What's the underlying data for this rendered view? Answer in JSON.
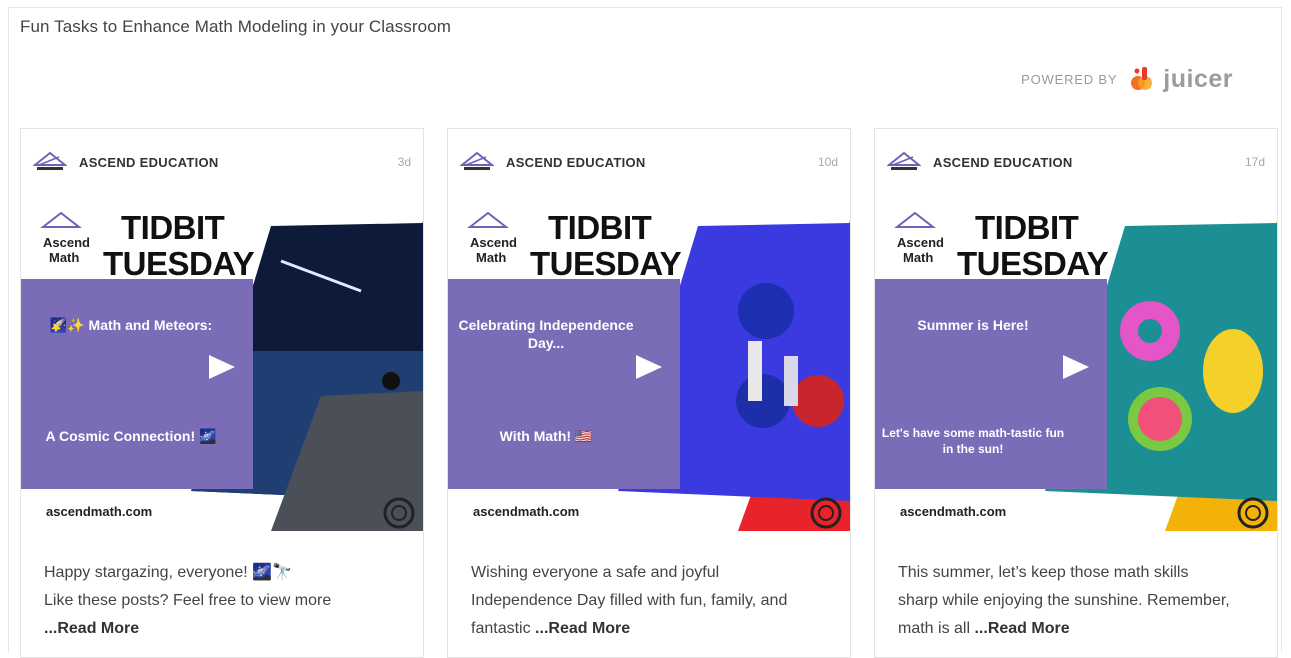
{
  "feed": {
    "title": "Fun Tasks to Enhance Math Modeling in your Classroom",
    "powered_by": "POWERED BY",
    "juicer": "juicer"
  },
  "colors": {
    "panel_purple": "#7b6cb8",
    "stripe_1": "#4b3ad0",
    "stripe_2": "#e8232a",
    "stripe_3": "#f2b208",
    "juicer_orange": "#f36f2a"
  },
  "posts": [
    {
      "author": "ASCEND EDUCATION",
      "age": "3d",
      "logo_line1": "Ascend",
      "logo_line2": "Math",
      "title_line1": "TIDBIT",
      "title_line2": "TUESDAY",
      "panel_top": "🌠✨ Math and Meteors:",
      "panel_bottom": "A Cosmic Connection! 🌌",
      "site": "ascendmath.com",
      "caption_line1": "Happy stargazing, everyone! 🌌🔭",
      "caption_line2": "Like these posts? Feel free to view more",
      "read_more": "...Read More",
      "image": "night-lake-icon"
    },
    {
      "author": "ASCEND EDUCATION",
      "age": "10d",
      "logo_line1": "Ascend",
      "logo_line2": "Math",
      "title_line1": "TIDBIT",
      "title_line2": "TUESDAY",
      "panel_top": "Celebrating Independence Day...",
      "panel_bottom": "With Math! 🇺🇸",
      "site": "ascendmath.com",
      "caption_line1": "Wishing everyone a safe and joyful",
      "caption_line2": "Independence Day filled with fun, family, and",
      "caption_line3": "fantastic",
      "read_more": "...Read More",
      "image": "balloons-icon"
    },
    {
      "author": "ASCEND EDUCATION",
      "age": "17d",
      "logo_line1": "Ascend",
      "logo_line2": "Math",
      "title_line1": "TIDBIT",
      "title_line2": "TUESDAY",
      "panel_top": "Summer is Here!",
      "panel_bottom": "Let's have some math-tastic fun in the sun!",
      "site": "ascendmath.com",
      "caption_line1": "This summer, let’s keep those math skills",
      "caption_line2": "sharp while enjoying the sunshine. Remember,",
      "caption_line3": "math is all",
      "read_more": "...Read More",
      "image": "pool-floats-icon"
    }
  ]
}
